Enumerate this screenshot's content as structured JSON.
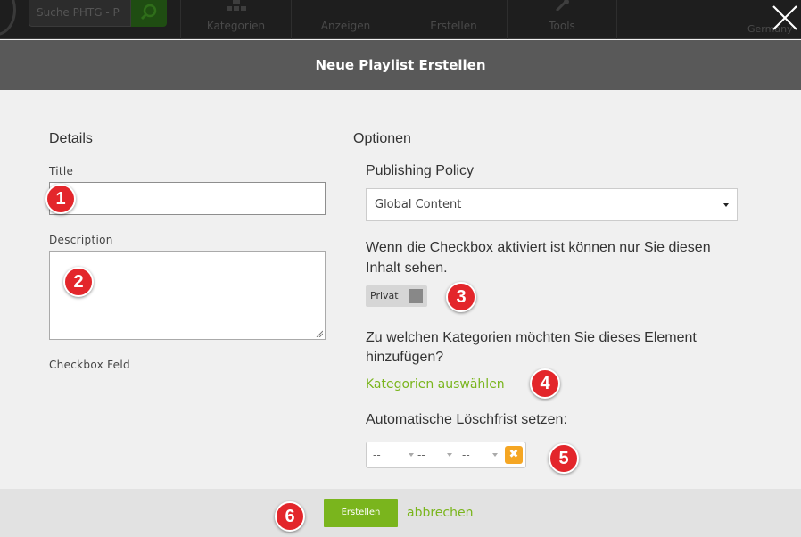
{
  "nav": {
    "search_placeholder": "Suche PHTG - P",
    "items": [
      "Kategorien",
      "Anzeigen",
      "Erstellen",
      "Tools"
    ],
    "language": "Germany"
  },
  "modal": {
    "title": "Neue Playlist Erstellen"
  },
  "details": {
    "heading": "Details",
    "title_label": "Title",
    "title_value": "",
    "description_label": "Description",
    "description_value": "",
    "checkbox_label": "Checkbox Feld"
  },
  "options": {
    "heading": "Optionen",
    "policy_label": "Publishing Policy",
    "policy_selected": "Global Content",
    "private_hint_line1": "Wenn die Checkbox aktiviert ist können nur Sie diesen",
    "private_hint_line2": "Inhalt sehen.",
    "private_toggle_label": "Privat",
    "categories_question_line1": "Zu welchen Kategorien möchten Sie dieses Element",
    "categories_question_line2": "hinzufügen?",
    "categories_link": "Kategorien auswählen",
    "delete_label": "Automatische Löschfrist setzen:",
    "date_day": "--",
    "date_month": "--",
    "date_year": "--"
  },
  "footer": {
    "create_label": "Erstellen",
    "cancel_label": "abbrechen"
  },
  "badges": [
    "1",
    "2",
    "3",
    "4",
    "5",
    "6"
  ],
  "colors": {
    "accent_green": "#7ab51d",
    "badge_red": "#e3262b",
    "header_gray": "#595959",
    "clear_orange": "#f5a623"
  }
}
